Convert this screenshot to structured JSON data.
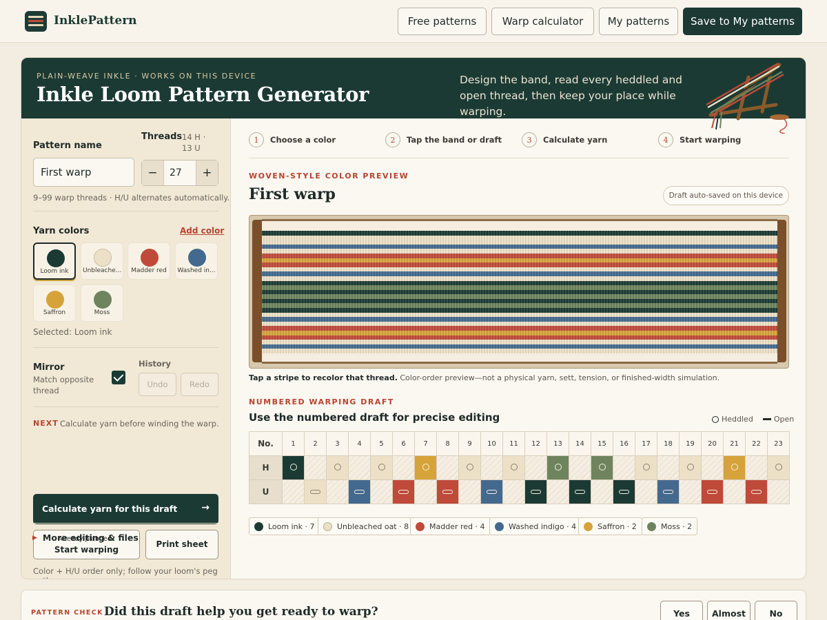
{
  "nav": {
    "brand": "InklePattern",
    "free_patterns": "Free patterns",
    "warp_calculator": "Warp calculator",
    "my_patterns": "My patterns",
    "save": "Save to My patterns"
  },
  "hero": {
    "eyebrow": "PLAIN-WEAVE INKLE · WORKS ON THIS DEVICE",
    "title": "Inkle Loom Pattern Generator",
    "description": "Design the band, read every heddled and open thread, then keep your place while warping."
  },
  "sidebar": {
    "pattern_name_label": "Pattern name",
    "pattern_name_value": "First warp",
    "threads_label": "Threads",
    "threads_meta": "14 H · 13 U",
    "threads_value": "27",
    "minus": "−",
    "plus": "+",
    "threads_help": "9–99 warp threads · H/U alternates automatically.",
    "yarn_colors_label": "Yarn colors",
    "add_color": "Add color",
    "selected_text": "Selected: Loom ink",
    "mirror_label": "Mirror",
    "mirror_help": "Match opposite thread",
    "mirror_checked": true,
    "history_label": "History",
    "undo": "Undo",
    "redo": "Redo",
    "next_tag": "NEXT",
    "next_text": "Calculate yarn before winding the warp.",
    "calc_button": "Calculate yarn for this draft",
    "calc_arrow": "→",
    "already_planned": "Already planned?",
    "start_warping": "Start warping",
    "print_sheet": "Print sheet",
    "footnote": "Color + H/U order only; follow your loom's peg path.",
    "more_editing": "More editing & files",
    "more_arrow": "▶"
  },
  "colors": [
    {
      "name": "Loom ink",
      "short": "Loom ink",
      "hex": "#1b3a33",
      "count": 7
    },
    {
      "name": "Unbleached oat",
      "short": "Unbleache...",
      "hex": "#ece0c6",
      "count": 8
    },
    {
      "name": "Madder red",
      "short": "Madder red",
      "hex": "#c04a3a",
      "count": 4
    },
    {
      "name": "Washed indigo",
      "short": "Washed in...",
      "hex": "#44698e",
      "count": 4
    },
    {
      "name": "Saffron",
      "short": "Saffron",
      "hex": "#d6a33a",
      "count": 2
    },
    {
      "name": "Moss",
      "short": "Moss",
      "hex": "#6e845e",
      "count": 2
    }
  ],
  "steps": [
    {
      "num": "1",
      "label": "Choose a color"
    },
    {
      "num": "2",
      "label": "Tap the band or draft"
    },
    {
      "num": "3",
      "label": "Calculate yarn"
    },
    {
      "num": "4",
      "label": "Start warping"
    }
  ],
  "preview": {
    "eyebrow": "WOVEN-STYLE COLOR PREVIEW",
    "title": "First warp",
    "autosave": "Draft auto-saved on this device",
    "caption_bold": "Tap a stripe to recolor that thread.",
    "caption_rest": " Color-order preview—not a physical yarn, sett, tension, or finished-width simulation."
  },
  "draft": {
    "eyebrow": "NUMBERED WARPING DRAFT",
    "title": "Use the numbered draft for precise editing",
    "heddled_label": "Heddled",
    "open_label": "Open",
    "col_header": "No.",
    "row_h": "H",
    "row_u": "U",
    "numbers": [
      "1",
      "2",
      "3",
      "4",
      "5",
      "6",
      "7",
      "8",
      "9",
      "10",
      "11",
      "12",
      "13",
      "14",
      "15",
      "16",
      "17",
      "18",
      "19",
      "20",
      "21",
      "22",
      "23"
    ],
    "thread_colors": [
      0,
      1,
      1,
      3,
      1,
      2,
      4,
      2,
      1,
      3,
      1,
      0,
      5,
      0,
      5,
      0,
      1,
      3,
      1,
      2,
      4,
      2,
      1
    ]
  },
  "warp_sequence": [
    0,
    1,
    1,
    3,
    1,
    2,
    4,
    2,
    1,
    3,
    1,
    0,
    5,
    0,
    5,
    0,
    5,
    0,
    1,
    3,
    1,
    2,
    4,
    2,
    1,
    3,
    1
  ],
  "feedback": {
    "eyebrow": "PATTERN CHECK",
    "question": "Did this draft help you get ready to warp?",
    "yes": "Yes",
    "almost": "Almost",
    "no": "No"
  }
}
